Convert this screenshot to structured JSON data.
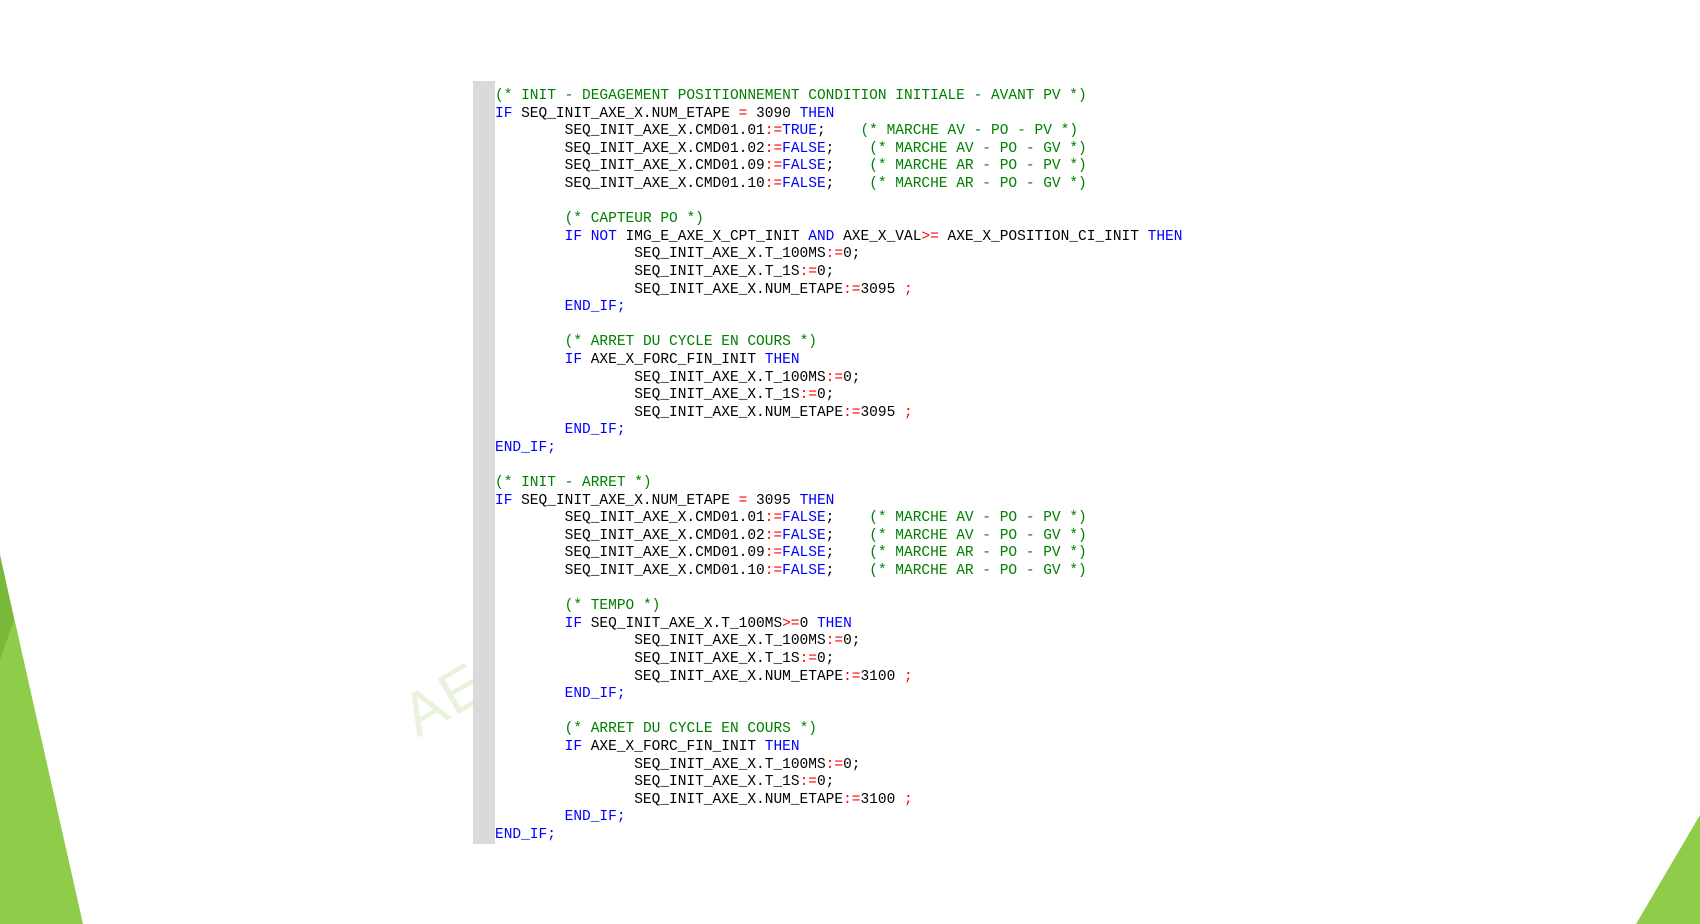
{
  "watermark": "AEI",
  "colors": {
    "keyword": "#0000ff",
    "comment": "#008000",
    "operator": "#ff0000",
    "text": "#000000",
    "gutter": "#dadada",
    "accent_green": "#8fcc4a"
  },
  "code": [
    [
      [
        "(* INIT - DEGAGEMENT POSITIONNEMENT CONDITION INITIALE - AVANT PV *)",
        "cm"
      ]
    ],
    [
      [
        "IF",
        "kw"
      ],
      [
        " SEQ_INIT_AXE_X.NUM_ETAPE ",
        ""
      ],
      [
        "=",
        "op"
      ],
      [
        " 3090 ",
        ""
      ],
      [
        "THEN",
        "kw"
      ]
    ],
    [
      [
        "        SEQ_INIT_AXE_X.CMD01.01",
        ""
      ],
      [
        ":=",
        "op"
      ],
      [
        "TRUE",
        "kw"
      ],
      [
        ";    ",
        ""
      ],
      [
        "(* MARCHE AV - PO - PV *)",
        "cm"
      ]
    ],
    [
      [
        "        SEQ_INIT_AXE_X.CMD01.02",
        ""
      ],
      [
        ":=",
        "op"
      ],
      [
        "FALSE",
        "kw"
      ],
      [
        ";    ",
        ""
      ],
      [
        "(* MARCHE AV - PO - GV *)",
        "cm"
      ]
    ],
    [
      [
        "        SEQ_INIT_AXE_X.CMD01.09",
        ""
      ],
      [
        ":=",
        "op"
      ],
      [
        "FALSE",
        "kw"
      ],
      [
        ";    ",
        ""
      ],
      [
        "(* MARCHE AR - PO - PV *)",
        "cm"
      ]
    ],
    [
      [
        "        SEQ_INIT_AXE_X.CMD01.10",
        ""
      ],
      [
        ":=",
        "op"
      ],
      [
        "FALSE",
        "kw"
      ],
      [
        ";    ",
        ""
      ],
      [
        "(* MARCHE AR - PO - GV *)",
        "cm"
      ]
    ],
    [],
    [
      [
        "        ",
        ""
      ],
      [
        "(* CAPTEUR PO *)",
        "cm"
      ]
    ],
    [
      [
        "        ",
        ""
      ],
      [
        "IF NOT",
        "kw"
      ],
      [
        " IMG_E_AXE_X_CPT_INIT ",
        ""
      ],
      [
        "AND",
        "kw"
      ],
      [
        " AXE_X_VAL",
        ""
      ],
      [
        ">=",
        "op"
      ],
      [
        " AXE_X_POSITION_CI_INIT ",
        ""
      ],
      [
        "THEN",
        "kw"
      ]
    ],
    [
      [
        "                SEQ_INIT_AXE_X.T_100MS",
        ""
      ],
      [
        ":=",
        "op"
      ],
      [
        "0;",
        ""
      ]
    ],
    [
      [
        "                SEQ_INIT_AXE_X.T_1S",
        ""
      ],
      [
        ":=",
        "op"
      ],
      [
        "0;",
        ""
      ]
    ],
    [
      [
        "                SEQ_INIT_AXE_X.NUM_ETAPE",
        ""
      ],
      [
        ":=",
        "op"
      ],
      [
        "3095 ",
        ""
      ],
      [
        ";",
        "op"
      ]
    ],
    [
      [
        "        ",
        ""
      ],
      [
        "END_IF;",
        "kw"
      ]
    ],
    [],
    [
      [
        "        ",
        ""
      ],
      [
        "(* ARRET DU CYCLE EN COURS *)",
        "cm"
      ]
    ],
    [
      [
        "        ",
        ""
      ],
      [
        "IF",
        "kw"
      ],
      [
        " AXE_X_FORC_FIN_INIT ",
        ""
      ],
      [
        "THEN",
        "kw"
      ]
    ],
    [
      [
        "                SEQ_INIT_AXE_X.T_100MS",
        ""
      ],
      [
        ":=",
        "op"
      ],
      [
        "0;",
        ""
      ]
    ],
    [
      [
        "                SEQ_INIT_AXE_X.T_1S",
        ""
      ],
      [
        ":=",
        "op"
      ],
      [
        "0;",
        ""
      ]
    ],
    [
      [
        "                SEQ_INIT_AXE_X.NUM_ETAPE",
        ""
      ],
      [
        ":=",
        "op"
      ],
      [
        "3095 ",
        ""
      ],
      [
        ";",
        "op"
      ]
    ],
    [
      [
        "        ",
        ""
      ],
      [
        "END_IF;",
        "kw"
      ]
    ],
    [
      [
        "END_IF;",
        "kw"
      ]
    ],
    [],
    [
      [
        "(* INIT - ARRET *)",
        "cm"
      ]
    ],
    [
      [
        "IF",
        "kw"
      ],
      [
        " SEQ_INIT_AXE_X.NUM_ETAPE ",
        ""
      ],
      [
        "=",
        "op"
      ],
      [
        " 3095 ",
        ""
      ],
      [
        "THEN",
        "kw"
      ]
    ],
    [
      [
        "        SEQ_INIT_AXE_X.CMD01.01",
        ""
      ],
      [
        ":=",
        "op"
      ],
      [
        "FALSE",
        "kw"
      ],
      [
        ";    ",
        ""
      ],
      [
        "(* MARCHE AV - PO - PV *)",
        "cm"
      ]
    ],
    [
      [
        "        SEQ_INIT_AXE_X.CMD01.02",
        ""
      ],
      [
        ":=",
        "op"
      ],
      [
        "FALSE",
        "kw"
      ],
      [
        ";    ",
        ""
      ],
      [
        "(* MARCHE AV - PO - GV *)",
        "cm"
      ]
    ],
    [
      [
        "        SEQ_INIT_AXE_X.CMD01.09",
        ""
      ],
      [
        ":=",
        "op"
      ],
      [
        "FALSE",
        "kw"
      ],
      [
        ";    ",
        ""
      ],
      [
        "(* MARCHE AR - PO - PV *)",
        "cm"
      ]
    ],
    [
      [
        "        SEQ_INIT_AXE_X.CMD01.10",
        ""
      ],
      [
        ":=",
        "op"
      ],
      [
        "FALSE",
        "kw"
      ],
      [
        ";    ",
        ""
      ],
      [
        "(* MARCHE AR - PO - GV *)",
        "cm"
      ]
    ],
    [],
    [
      [
        "        ",
        ""
      ],
      [
        "(* TEMPO *)",
        "cm"
      ]
    ],
    [
      [
        "        ",
        ""
      ],
      [
        "IF",
        "kw"
      ],
      [
        " SEQ_INIT_AXE_X.T_100MS",
        ""
      ],
      [
        ">=",
        "op"
      ],
      [
        "0 ",
        ""
      ],
      [
        "THEN",
        "kw"
      ]
    ],
    [
      [
        "                SEQ_INIT_AXE_X.T_100MS",
        ""
      ],
      [
        ":=",
        "op"
      ],
      [
        "0;",
        ""
      ]
    ],
    [
      [
        "                SEQ_INIT_AXE_X.T_1S",
        ""
      ],
      [
        ":=",
        "op"
      ],
      [
        "0;",
        ""
      ]
    ],
    [
      [
        "                SEQ_INIT_AXE_X.NUM_ETAPE",
        ""
      ],
      [
        ":=",
        "op"
      ],
      [
        "3100 ",
        ""
      ],
      [
        ";",
        "op"
      ]
    ],
    [
      [
        "        ",
        ""
      ],
      [
        "END_IF;",
        "kw"
      ]
    ],
    [],
    [
      [
        "        ",
        ""
      ],
      [
        "(* ARRET DU CYCLE EN COURS *)",
        "cm"
      ]
    ],
    [
      [
        "        ",
        ""
      ],
      [
        "IF",
        "kw"
      ],
      [
        " AXE_X_FORC_FIN_INIT ",
        ""
      ],
      [
        "THEN",
        "kw"
      ]
    ],
    [
      [
        "                SEQ_INIT_AXE_X.T_100MS",
        ""
      ],
      [
        ":=",
        "op"
      ],
      [
        "0;",
        ""
      ]
    ],
    [
      [
        "                SEQ_INIT_AXE_X.T_1S",
        ""
      ],
      [
        ":=",
        "op"
      ],
      [
        "0;",
        ""
      ]
    ],
    [
      [
        "                SEQ_INIT_AXE_X.NUM_ETAPE",
        ""
      ],
      [
        ":=",
        "op"
      ],
      [
        "3100 ",
        ""
      ],
      [
        ";",
        "op"
      ]
    ],
    [
      [
        "        ",
        ""
      ],
      [
        "END_IF;",
        "kw"
      ]
    ],
    [
      [
        "END_IF;",
        "kw"
      ]
    ]
  ]
}
